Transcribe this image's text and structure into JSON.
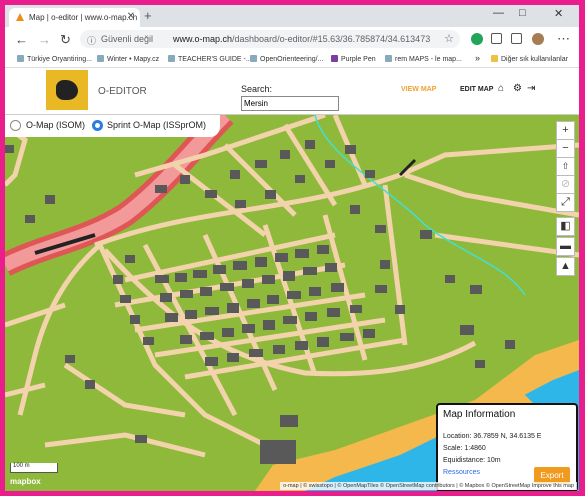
{
  "browser": {
    "tab_title": "Map | o-editor | www.o-map.ch",
    "new_tab": "+",
    "window_controls": [
      "—",
      "□",
      "✕"
    ],
    "security_label": "Güvenli değil",
    "url_host": "www.o-map.ch",
    "url_path": "/dashboard/o-editor/#15.63/36.785874/34.613473",
    "bookmarks": [
      "Türkiye Oryantiring...",
      "Winter • Mapy.cz",
      "TEACHER'S GUIDE -...",
      "OpenOrienteering/...",
      "Purple Pen",
      "rem MAPS - le map...",
      "»",
      "Diğer sık kullanılanlar"
    ]
  },
  "app": {
    "name": "O-EDITOR",
    "search_label": "Search:",
    "search_value": "Mersin",
    "view_map": "VIEW MAP",
    "edit_map": "EDIT MAP"
  },
  "map": {
    "toggle_options": [
      "O-Map (ISOM)",
      "Sprint O-Map (ISSprOM)"
    ],
    "selected_option": 1,
    "controls": [
      "+",
      "−",
      "⇧",
      "⊘",
      "⤢",
      "◧",
      "▬",
      "▲"
    ],
    "scale_label": "100 m",
    "mapbox_label": "mapbox",
    "attribution": "o-map | © swisstopo | © OpenMapTiles © OpenStreetMap contributors | © Mapbox © OpenStreetMap Improve this map",
    "colors": {
      "land": "#8fb93a",
      "road": "#f2d3ac",
      "building": "#595959",
      "water": "#2fb6e8",
      "sand": "#f5b84d",
      "highway": "#e05555"
    }
  },
  "info": {
    "title": "Map Information",
    "location": "Location: 36.7859 N, 34.6135 E",
    "scale": "Scale: 1:4860",
    "equidistance": "Equidistance: 10m",
    "resources": "Ressources",
    "export": "Export"
  }
}
